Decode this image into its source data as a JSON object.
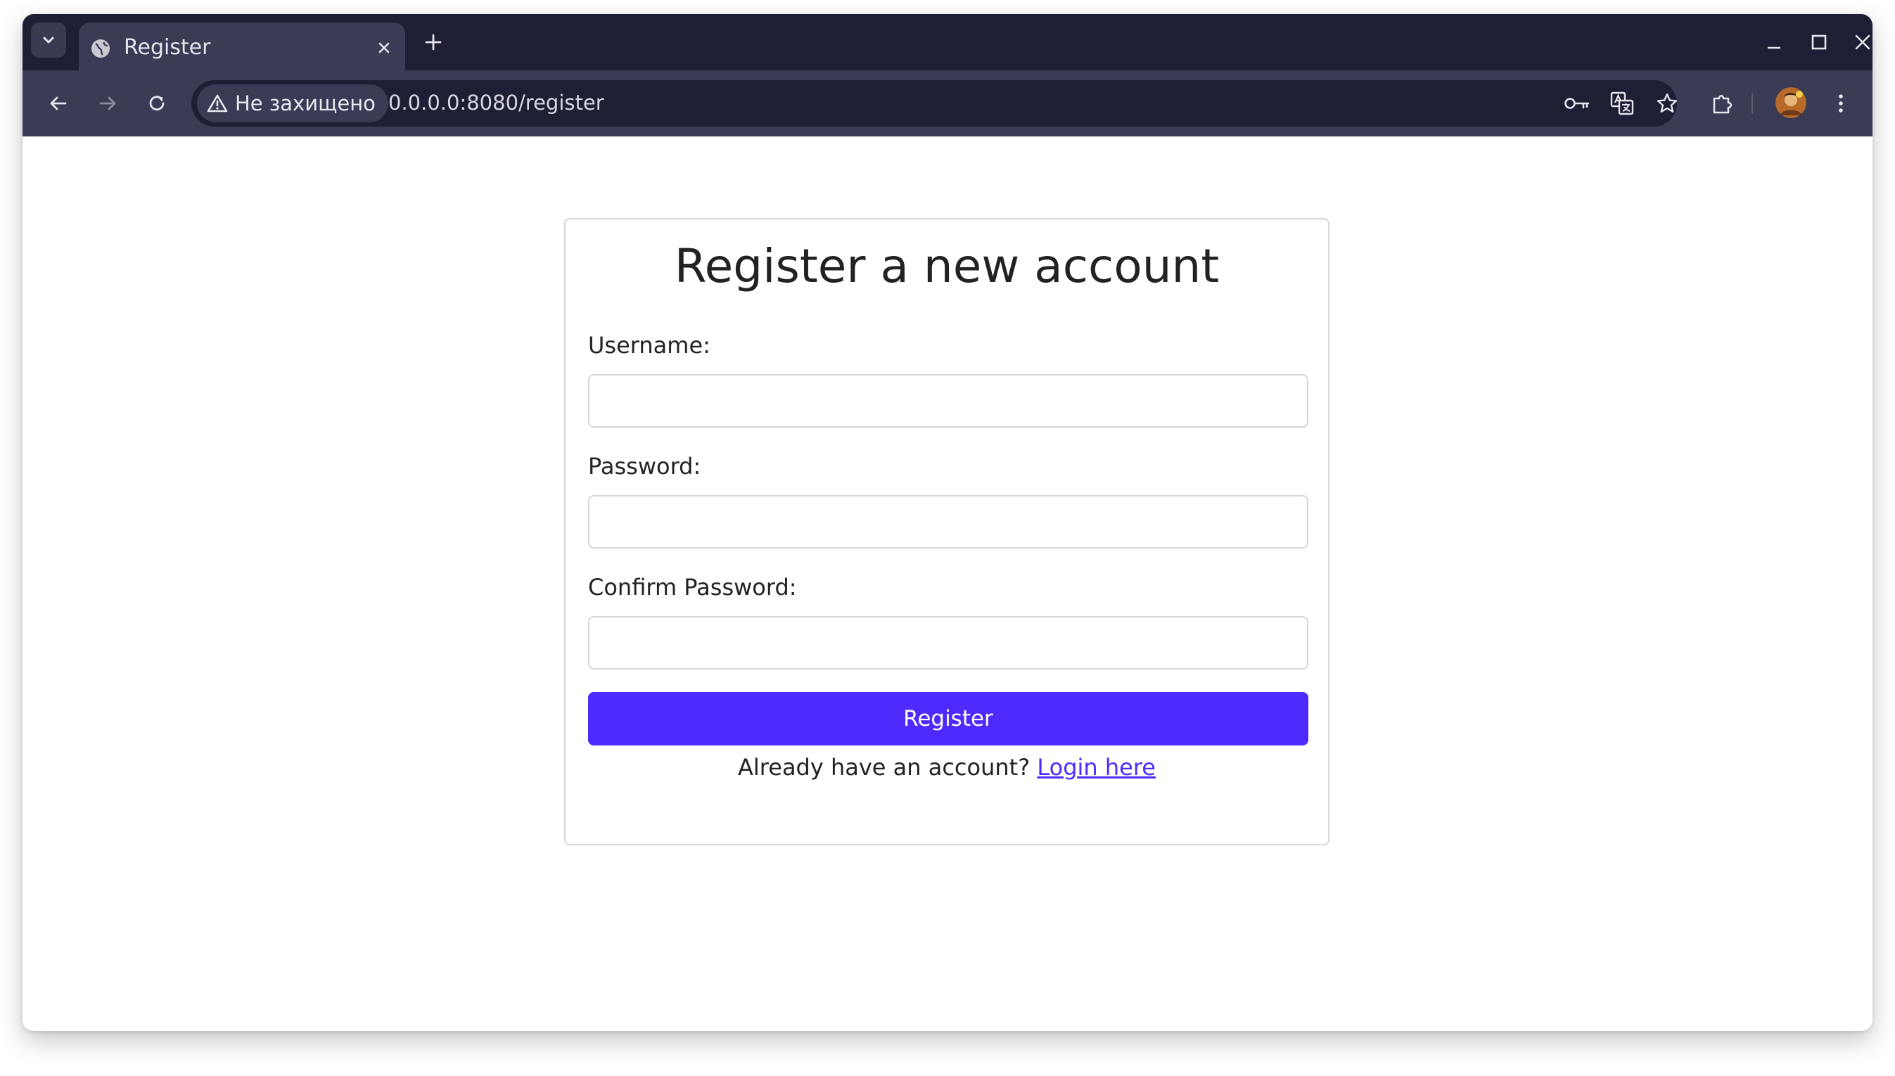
{
  "browser": {
    "tab": {
      "title": "Register"
    },
    "omnibox": {
      "security_label": "Не захищено",
      "url": "0.0.0.0:8080/register"
    },
    "icons": {
      "tab_search": "chevron-down-icon",
      "favicon": "globe-icon",
      "tab_close": "close-icon",
      "new_tab": "plus-icon",
      "minimize": "minimize-icon",
      "maximize": "maximize-icon",
      "close_window": "close-icon",
      "back": "arrow-left-icon",
      "forward": "arrow-right-icon",
      "reload": "reload-icon",
      "warning": "warning-triangle-icon",
      "password_key": "key-icon",
      "translate": "translate-icon",
      "bookmark": "star-icon",
      "extensions": "puzzle-icon",
      "profile": "avatar",
      "menu": "kebab-menu-icon"
    },
    "colors": {
      "tabstrip_bg": "#1e1f35",
      "toolbar_bg": "#3a3b54",
      "omnibox_bg": "#1e1f35"
    }
  },
  "page": {
    "title": "Register a new account",
    "fields": {
      "username_label": "Username:",
      "username_value": "",
      "password_label": "Password:",
      "password_value": "",
      "confirm_label": "Confirm Password:",
      "confirm_value": ""
    },
    "submit_label": "Register",
    "footer": {
      "text": "Already have an account? ",
      "link_text": "Login here"
    },
    "colors": {
      "accent": "#4f2aff",
      "text": "#222222",
      "border": "#d6d6da"
    }
  }
}
